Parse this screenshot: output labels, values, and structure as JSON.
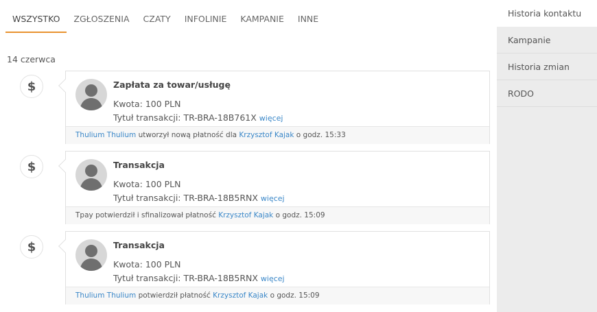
{
  "tabs": [
    "WSZYSTKO",
    "ZGŁOSZENIA",
    "CZATY",
    "INFOLINIE",
    "KAMPANIE",
    "INNE"
  ],
  "date_heading": "14 czerwca",
  "side_menu": [
    "Historia kontaktu",
    "Kampanie",
    "Historia zmian",
    "RODO"
  ],
  "entries": [
    {
      "icon": "dollar-icon",
      "title": "Zapłata za towar/usługę",
      "amount": "Kwota: 100 PLN",
      "transaction": "Tytuł transakcji: TR-BRA-18B761X",
      "more": "więcej",
      "foot_actor": "Thulium Thulium",
      "foot_text": "utworzył nową płatność dla",
      "foot_client": "Krzysztof Kajak",
      "foot_time": "o godz. 15:33"
    },
    {
      "icon": "dollar-icon",
      "title": "Transakcja",
      "amount": "Kwota: 100 PLN",
      "transaction": "Tytuł transakcji: TR-BRA-18B5RNX",
      "more": "więcej",
      "foot_actor": "",
      "foot_text": "Tpay potwierdził i sfinalizował płatność",
      "foot_client": "Krzysztof Kajak",
      "foot_time": "o godz. 15:09"
    },
    {
      "icon": "dollar-icon",
      "title": "Transakcja",
      "amount": "Kwota: 100 PLN",
      "transaction": "Tytuł transakcji: TR-BRA-18B5RNX",
      "more": "więcej",
      "foot_actor": "Thulium Thulium",
      "foot_text": "potwierdził płatność",
      "foot_client": "Krzysztof Kajak",
      "foot_time": "o godz. 15:09"
    }
  ],
  "colors": {
    "accent": "#e8922f",
    "link": "#3a87c8",
    "panel": "#ececec"
  }
}
